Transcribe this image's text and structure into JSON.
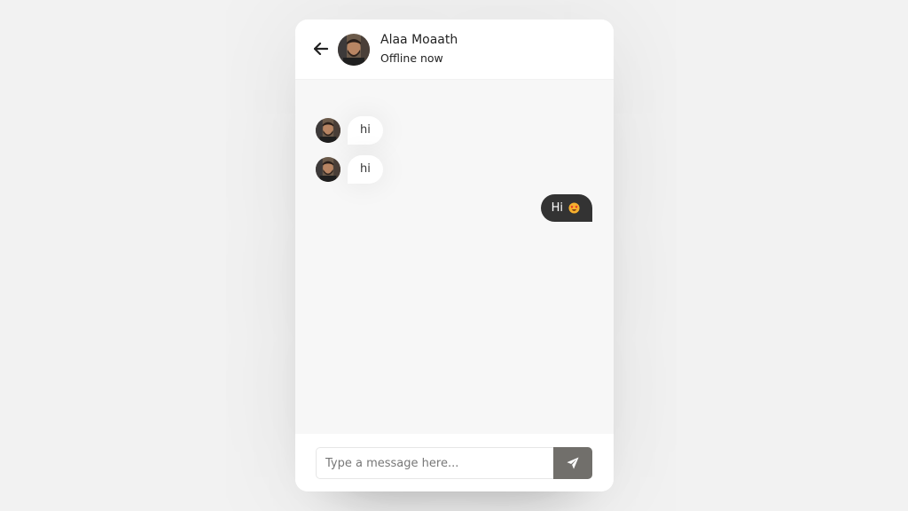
{
  "header": {
    "back_icon": "arrow-left-icon",
    "avatar": "avatar-photo",
    "name": "Alaa Moaath",
    "status": "Offline now"
  },
  "messages": [
    {
      "direction": "incoming",
      "text": "hi",
      "avatar": "avatar-photo"
    },
    {
      "direction": "incoming",
      "text": "hi",
      "avatar": "avatar-photo"
    },
    {
      "direction": "outgoing",
      "text": "Hi",
      "emoji": "star-struck-emoji-icon"
    }
  ],
  "typing": {
    "placeholder": "Type a message here...",
    "send_icon": "paper-plane-icon"
  },
  "colors": {
    "page_bg": "#f2f2f2",
    "chat_bg": "#f7f7f7",
    "outgoing_bubble": "#333333",
    "send_button": "#716f6b"
  }
}
